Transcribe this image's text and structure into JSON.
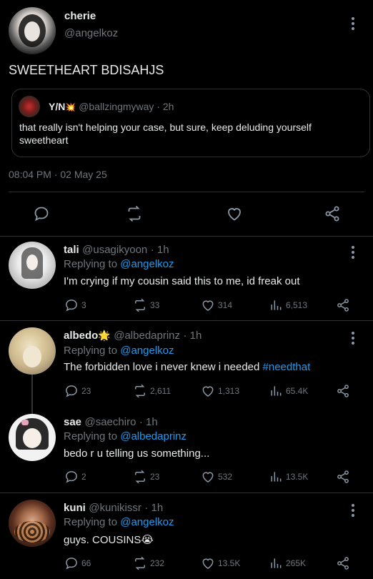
{
  "main_tweet": {
    "author_name": "cherie",
    "author_handle": "@angelkoz",
    "text": "SWEETHEART BDISAHJS",
    "timestamp": "08:04 PM · 02 May 25",
    "quoted": {
      "author_name": "Y/N",
      "author_emoji": "💥",
      "handle": "@ballzingmyway",
      "time": "· 2h",
      "text_line1": "that really isn't helping your case, but sure, keep deluding yourself",
      "text_line2": "sweetheart"
    }
  },
  "replies": [
    {
      "name": "tali",
      "name_emoji": "",
      "handle": "@usagikyoon",
      "time": "· 1h",
      "replying_prefix": "Replying to",
      "replying_to": "@angelkoz",
      "text": "I'm crying if my cousin said this to me, id freak out",
      "hashtag": "",
      "replies": "3",
      "reposts": "33",
      "likes": "314",
      "views": "6,513"
    },
    {
      "name": "albedo",
      "name_emoji": "🌟",
      "handle": "@albedaprinz",
      "time": "· 1h",
      "replying_prefix": "Replying to",
      "replying_to": "@angelkoz",
      "text": "The forbidden love i never knew i needed",
      "hashtag": "#needthat",
      "replies": "23",
      "reposts": "2,611",
      "likes": "1,313",
      "views": "65.4K"
    },
    {
      "name": "sae",
      "name_emoji": "",
      "handle": "@saechiro",
      "time": "· 1h",
      "replying_prefix": "Replying to",
      "replying_to": "@albedaprinz",
      "text": "bedo r u telling us something...",
      "hashtag": "",
      "replies": "2",
      "reposts": "23",
      "likes": "532",
      "views": "13.5K"
    },
    {
      "name": "kuni",
      "name_emoji": "",
      "handle": "@kunikissr",
      "time": "· 1h",
      "replying_prefix": "Replying to",
      "replying_to": "@angelkoz",
      "text": "guys. COUSINS😭",
      "hashtag": "",
      "replies": "66",
      "reposts": "232",
      "likes": "13.5K",
      "views": "265K"
    }
  ],
  "icons": {
    "reply": "comment-icon",
    "repost": "repost-icon",
    "like": "heart-icon",
    "views": "views-icon",
    "share": "share-icon",
    "more": "more-icon"
  },
  "colors": {
    "background": "#000000",
    "text": "#e7e9ea",
    "muted": "#71767b",
    "accent": "#1d9bf0",
    "divider": "#2f3336"
  }
}
